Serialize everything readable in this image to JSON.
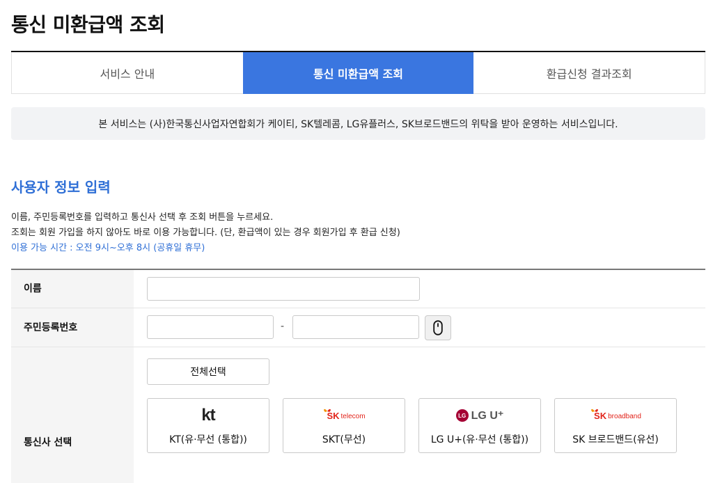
{
  "page": {
    "title": "통신 미환급액 조회"
  },
  "tabs": [
    {
      "label": "서비스 안내",
      "active": false
    },
    {
      "label": "통신 미환급액 조회",
      "active": true
    },
    {
      "label": "환급신청 결과조회",
      "active": false
    }
  ],
  "notice": {
    "text": "본 서비스는 (사)한국통신사업자연합회가 케이티, SK텔레콤, LG유플러스, SK브로드밴드의 위탁을 받아 운영하는 서비스입니다."
  },
  "section": {
    "title": "사용자 정보 입력",
    "desc_line1": "이름, 주민등록번호를 입력하고 통신사 선택 후 조회 버튼을 누르세요.",
    "desc_line2": "조회는 회원 가입을 하지 않아도 바로 이용 가능합니다. (단, 환급액이 있는 경우 회원가입 후 환급 신청)",
    "desc_hours": "이용 가능 시간 : 오전 9시~오후 8시 (공휴일 휴무)"
  },
  "form": {
    "name_label": "이름",
    "name_value": "",
    "ssn_label": "주민등록번호",
    "ssn_front_value": "",
    "ssn_back_value": "",
    "ssn_dash": "-",
    "carrier_label": "통신사 선택",
    "select_all_label": "전체선택",
    "carriers": [
      {
        "logo_text": "kt",
        "label": "KT(유·무선 (통합))"
      },
      {
        "logo_text": "SK",
        "logo_sub": "telecom",
        "label": "SKT(무선)"
      },
      {
        "logo_mark": "LG",
        "logo_text": "LG U⁺",
        "label": "LG U+(유·무선 (통합))"
      },
      {
        "logo_text": "SK",
        "logo_sub": "broadband",
        "label": "SK 브로드밴드(유선)"
      }
    ]
  },
  "colors": {
    "accent": "#3a76e0",
    "section_title": "#2f6fd6",
    "sk_red": "#e2231a",
    "lg_red": "#a50034"
  },
  "icons": {
    "mouse_button": "mouse-icon"
  }
}
